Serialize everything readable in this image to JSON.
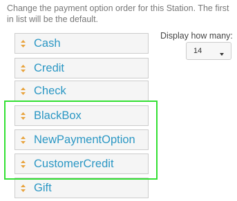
{
  "instructions": "Change the payment option order for this Station. The first in list will be the default.",
  "payment_options": [
    {
      "label": "Cash"
    },
    {
      "label": "Credit"
    },
    {
      "label": "Check"
    },
    {
      "label": "BlackBox"
    },
    {
      "label": "NewPaymentOption"
    },
    {
      "label": "CustomerCredit"
    },
    {
      "label": "Gift"
    }
  ],
  "display": {
    "label": "Display how many:",
    "selected": "14"
  },
  "colors": {
    "label_text": "#2b97c4",
    "drag_handle": "#e8a33d",
    "highlight": "#32e032",
    "item_background": "#f5f5f5"
  },
  "icons": {
    "drag_handle": "sort-arrows-icon",
    "select_caret": "caret-down-icon"
  }
}
